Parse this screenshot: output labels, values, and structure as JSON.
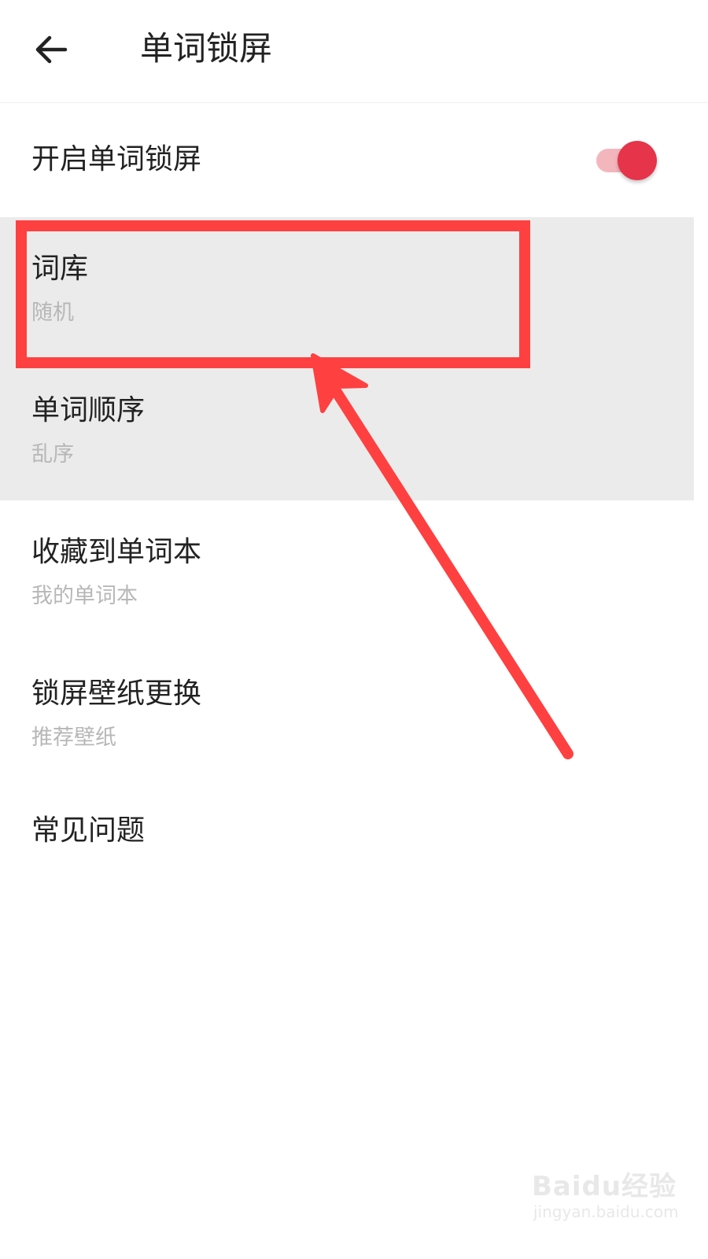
{
  "header": {
    "title": "单词锁屏",
    "back_icon": "arrow-left-icon"
  },
  "toggle_row": {
    "label": "开启单词锁屏",
    "enabled": true,
    "accent_color": "#e6344a",
    "track_color": "#f4b6bd"
  },
  "settings": [
    {
      "title": "词库",
      "value": "随机"
    },
    {
      "title": "单词顺序",
      "value": "乱序"
    },
    {
      "title": "收藏到单词本",
      "value": "我的单词本"
    },
    {
      "title": "锁屏壁纸更换",
      "value": "推荐壁纸"
    },
    {
      "title": "常见问题"
    }
  ],
  "annotation": {
    "color": "#ff4040",
    "target": "词库"
  },
  "watermark": {
    "brand": "Baidu经验",
    "url": "jingyan.baidu.com"
  }
}
